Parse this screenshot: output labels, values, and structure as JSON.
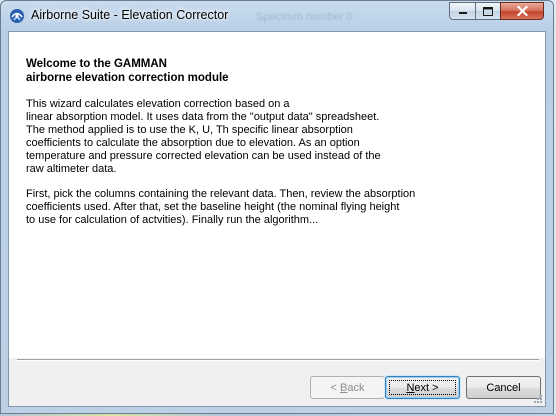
{
  "window": {
    "title": "Airborne Suite - Elevation Corrector",
    "background_title": "Spectrum number 0"
  },
  "wizard": {
    "heading": "Welcome to the GAMMAN\nairborne elevation correction module",
    "paragraph1": "This wizard calculates elevation correction based on a\nlinear absorption model. It uses data from the \"output data\" spreadsheet.\nThe method applied is to use the K, U, Th specific linear absorption\ncoefficients to calculate the absorption due to elevation. As an option\ntemperature and pressure corrected elevation can be used instead of the\nraw altimeter data.",
    "paragraph2": "First, pick the columns containing the relevant data. Then, review the absorption\ncoefficients used. After that, set the baseline height (the nominal flying height\nto use for calculation of actvities). Finally run the algorithm..."
  },
  "buttons": {
    "back_pre": "< ",
    "back_accel": "B",
    "back_post": "ack",
    "back_enabled": false,
    "next_pre": "",
    "next_accel": "N",
    "next_post": "ext >",
    "cancel": "Cancel"
  },
  "icons": {
    "app": "gamman-app-icon",
    "minimize": "minimize-icon",
    "maximize": "maximize-icon",
    "close": "close-icon"
  },
  "colors": {
    "title_bar": "#c9dcee",
    "close_button": "#c4462d",
    "default_button_border": "#3c7fb1"
  }
}
